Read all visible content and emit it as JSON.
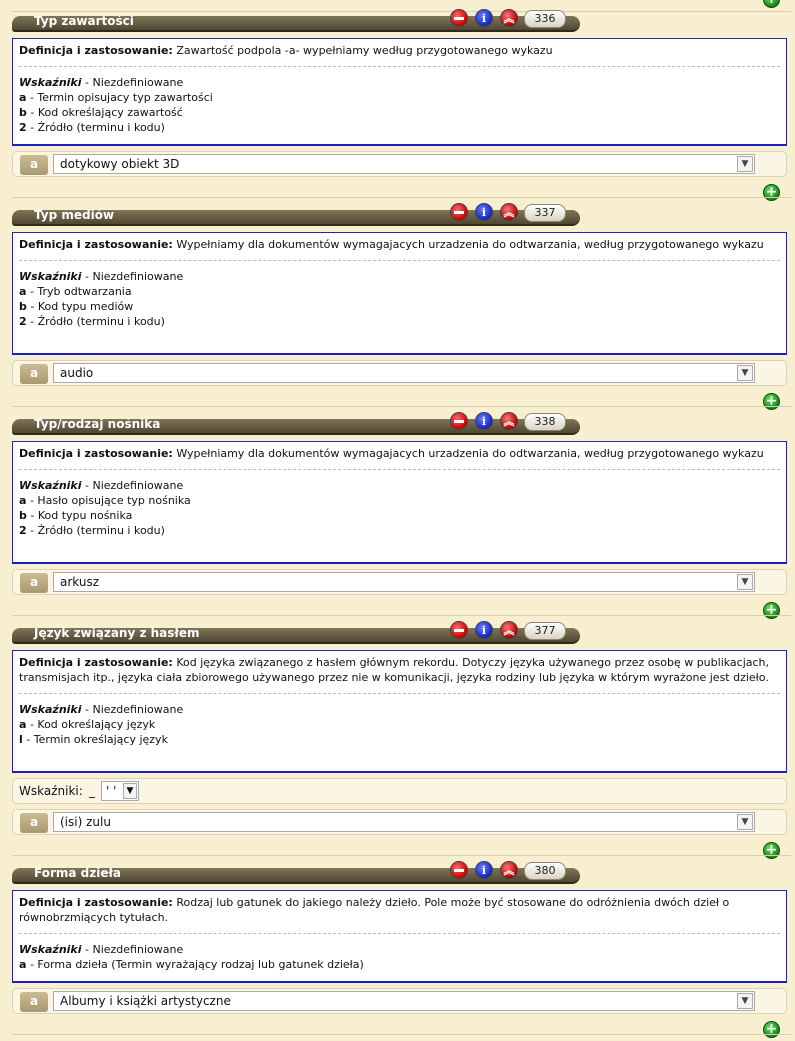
{
  "colors": {
    "header": "#5f563f",
    "box_border": "#1c1ec0",
    "background": "#f7efcf"
  },
  "fields": [
    {
      "title": "Typ zawartości",
      "tag": "336",
      "def_label": "Definicja i zastosowanie:",
      "def_text": "Zawartość podpola -a- wypełniamy według przygotowanego wykazu",
      "ind_label": "Wskaźniki",
      "ind_value": "- Niezdefiniowane",
      "subfields": [
        {
          "code": "a",
          "desc": "- Termin opisujacy typ zawartości"
        },
        {
          "code": "b",
          "desc": "- Kod określający zawartość"
        },
        {
          "code": "2",
          "desc": "- Źródło (terminu i kodu)"
        }
      ],
      "subfield_code": "a",
      "value": "dotykowy obiekt 3D"
    },
    {
      "title": "Typ mediów",
      "tag": "337",
      "def_label": "Definicja i zastosowanie:",
      "def_text": "Wypełniamy dla dokumentów wymagajacych urzadzenia do odtwarzania, według przygotowanego wykazu",
      "ind_label": "Wskaźniki",
      "ind_value": "- Niezdefiniowane",
      "subfields": [
        {
          "code": "a",
          "desc": "- Tryb odtwarzania"
        },
        {
          "code": "b",
          "desc": "- Kod typu mediów"
        },
        {
          "code": "2",
          "desc": "- Źródło (terminu i kodu)"
        }
      ],
      "subfield_code": "a",
      "value": "audio"
    },
    {
      "title": "Typ/rodzaj nośnika",
      "tag": "338",
      "def_label": "Definicja i zastosowanie:",
      "def_text": "Wypełniamy dla dokumentów wymagajacych urzadzenia do odtwarzania, według przygotowanego wykazu",
      "ind_label": "Wskaźniki",
      "ind_value": "- Niezdefiniowane",
      "subfields": [
        {
          "code": "a",
          "desc": "- Hasło opisujące typ nośnika"
        },
        {
          "code": "b",
          "desc": "- Kod typu nośnika"
        },
        {
          "code": "2",
          "desc": "- Źródło (terminu i kodu)"
        }
      ],
      "subfield_code": "a",
      "value": "arkusz"
    },
    {
      "title": "Język związany z hasłem",
      "tag": "377",
      "def_label": "Definicja i zastosowanie:",
      "def_text": "Kod języka związanego z hasłem głównym rekordu. Dotyczy języka używanego przez osobę w publikacjach, transmisjach itp., języka ciała zbiorowego używanego przez nie w komunikacji, języka rodziny lub języka w którym wyrażone jest dzieło.",
      "ind_label": "Wskaźniki",
      "ind_value": "- Niezdefiniowane",
      "subfields": [
        {
          "code": "a",
          "desc": "- Kod określający język"
        },
        {
          "code": "l",
          "desc": "- Termin określający język"
        }
      ],
      "indicators_label": "Wskaźniki:",
      "indicator1": "_",
      "indicator2": "' '",
      "subfield_code": "a",
      "value": "(isi) zulu"
    },
    {
      "title": "Forma dzieła",
      "tag": "380",
      "def_label": "Definicja i zastosowanie:",
      "def_text": "Rodzaj lub gatunek do jakiego należy dzieło. Pole może być stosowane do odróżnienia dwóch dzieł o równobrzmiących tytułach.",
      "ind_label": "Wskaźniki",
      "ind_value": "- Niezdefiniowane",
      "subfields": [
        {
          "code": "a",
          "desc": "- Forma dzieła (Termin wyrażający rodzaj lub gatunek dzieła)"
        }
      ],
      "subfield_code": "a",
      "value": "Albumy i książki artystyczne"
    }
  ],
  "icons": {
    "delete": "remove-icon",
    "info": "info-icon",
    "up": "move-up-icon",
    "add": "add-icon"
  },
  "info_glyph": "i"
}
